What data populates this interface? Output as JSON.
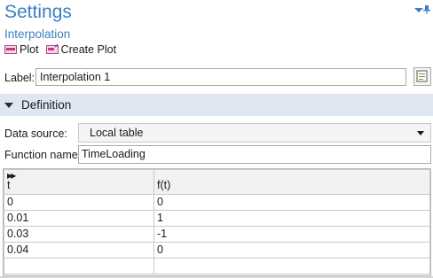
{
  "header": {
    "title": "Settings",
    "subtitle": "Interpolation"
  },
  "toolbar": {
    "plot_label": "Plot",
    "create_plot_label": "Create Plot"
  },
  "label_row": {
    "caption": "Label:",
    "value": "Interpolation 1"
  },
  "definition": {
    "title": "Definition",
    "data_source_caption": "Data source:",
    "data_source_value": "Local table",
    "function_name_caption": "Function name:",
    "function_name_value": "TimeLoading"
  },
  "table": {
    "columns": [
      "t",
      "f(t)"
    ],
    "rows": [
      [
        "0",
        "0"
      ],
      [
        "0.01",
        "1"
      ],
      [
        "0.03",
        "-1"
      ],
      [
        "0.04",
        "0"
      ],
      [
        "",
        ""
      ]
    ]
  },
  "colors": {
    "accent": "#3b7fc4",
    "section_bg": "#dfe7f2"
  },
  "icons": {
    "plot": "plot-icon",
    "create_plot": "create-plot-icon",
    "pin": "pin-icon",
    "dropdown": "dropdown-arrow-icon"
  }
}
